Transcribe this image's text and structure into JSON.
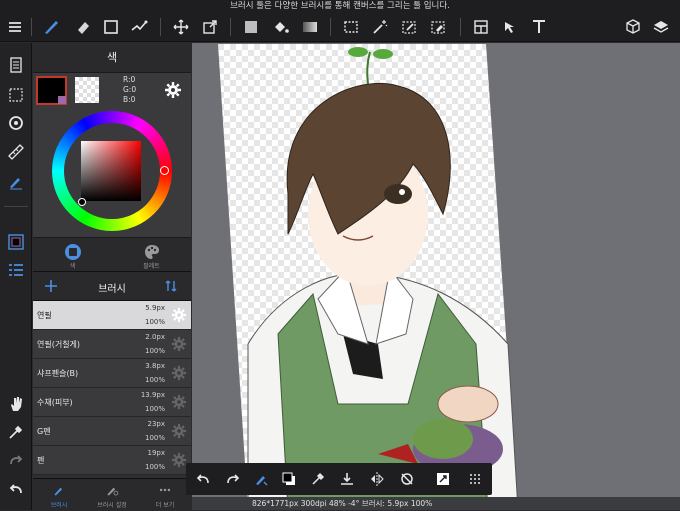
{
  "tooltip": "브러시 툴은 다양한 브러시를 통해 캔버스를 그리는 툴 입니다.",
  "color_panel": {
    "title": "색",
    "rgb": {
      "r": "R:0",
      "g": "G:0",
      "b": "B:0"
    },
    "tabs": [
      {
        "label": "색",
        "icon": "color-circle-icon"
      },
      {
        "label": "팔레트",
        "icon": "palette-icon"
      }
    ]
  },
  "brush_panel": {
    "title": "브러시",
    "brushes": [
      {
        "name": "연필",
        "size": "5.9px",
        "opacity": "100%",
        "selected": true
      },
      {
        "name": "연필(거칠게)",
        "size": "2.0px",
        "opacity": "100%",
        "selected": false
      },
      {
        "name": "샤프펜슬(B)",
        "size": "3.8px",
        "opacity": "100%",
        "selected": false
      },
      {
        "name": "수채(피부)",
        "size": "13.9px",
        "opacity": "100%",
        "selected": false
      },
      {
        "name": "G펜",
        "size": "23px",
        "opacity": "100%",
        "selected": false
      },
      {
        "name": "펜",
        "size": "19px",
        "opacity": "100%",
        "selected": false
      }
    ],
    "bottom_tabs": [
      {
        "label": "브러시",
        "active": true
      },
      {
        "label": "브러시 설정",
        "active": false
      },
      {
        "label": "더 보기",
        "active": false
      }
    ]
  },
  "status": "826*1771px 300dpi 48% -4° 브러시: 5.9px 100%",
  "colors": {
    "accent": "#4a90e2",
    "current_color": "#000000",
    "canvas_bg": "#6f7075"
  }
}
